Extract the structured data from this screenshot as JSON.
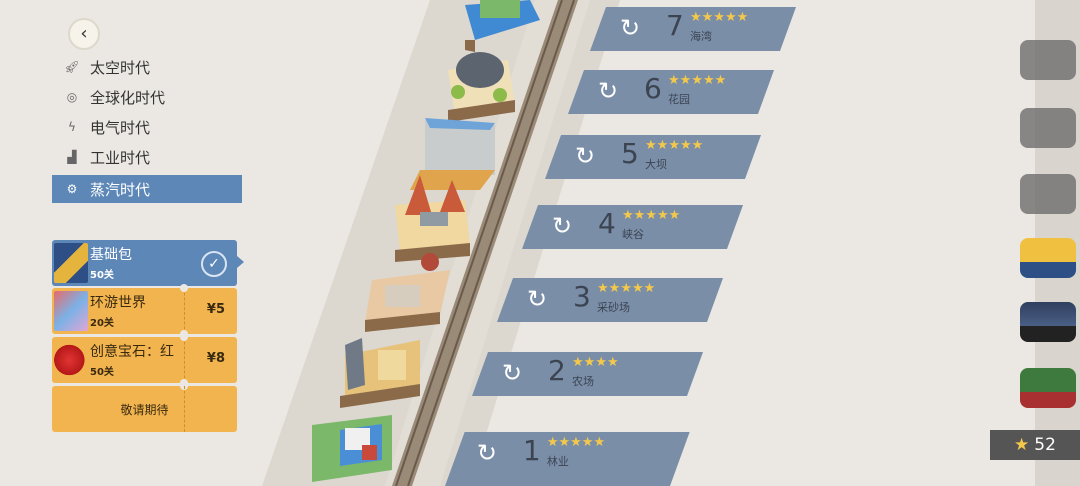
{
  "eras": [
    {
      "label": "太空时代",
      "icon": "rocket-icon",
      "selected": false
    },
    {
      "label": "全球化时代",
      "icon": "globe-icon",
      "selected": false
    },
    {
      "label": "电气时代",
      "icon": "lightning-icon",
      "selected": false
    },
    {
      "label": "工业时代",
      "icon": "factory-icon",
      "selected": false
    },
    {
      "label": "蒸汽时代",
      "icon": "gear-icon",
      "selected": true
    }
  ],
  "packs": [
    {
      "name": "基础包",
      "levels": "50关",
      "selected": true
    },
    {
      "name": "环游世界",
      "levels": "20关",
      "price": "¥5"
    },
    {
      "name": "创意宝石：红",
      "levels": "50关",
      "price": "¥8"
    }
  ],
  "coming_soon": "敬请期待",
  "levels": [
    {
      "number": "7",
      "name": "海湾",
      "stars": "★★★★★"
    },
    {
      "number": "6",
      "name": "花园",
      "stars": "★★★★★"
    },
    {
      "number": "5",
      "name": "大坝",
      "stars": "★★★★★"
    },
    {
      "number": "4",
      "name": "峡谷",
      "stars": "★★★★★"
    },
    {
      "number": "3",
      "name": "采砂场",
      "stars": "★★★★★"
    },
    {
      "number": "2",
      "name": "农场",
      "stars": "★★★★"
    },
    {
      "number": "1",
      "name": "林业",
      "stars": "★★★★★"
    }
  ],
  "score": "52",
  "icons": {
    "back": "back-arrow-icon",
    "replay": "replay-icon",
    "star": "star-icon",
    "check": "checkmark-icon"
  }
}
